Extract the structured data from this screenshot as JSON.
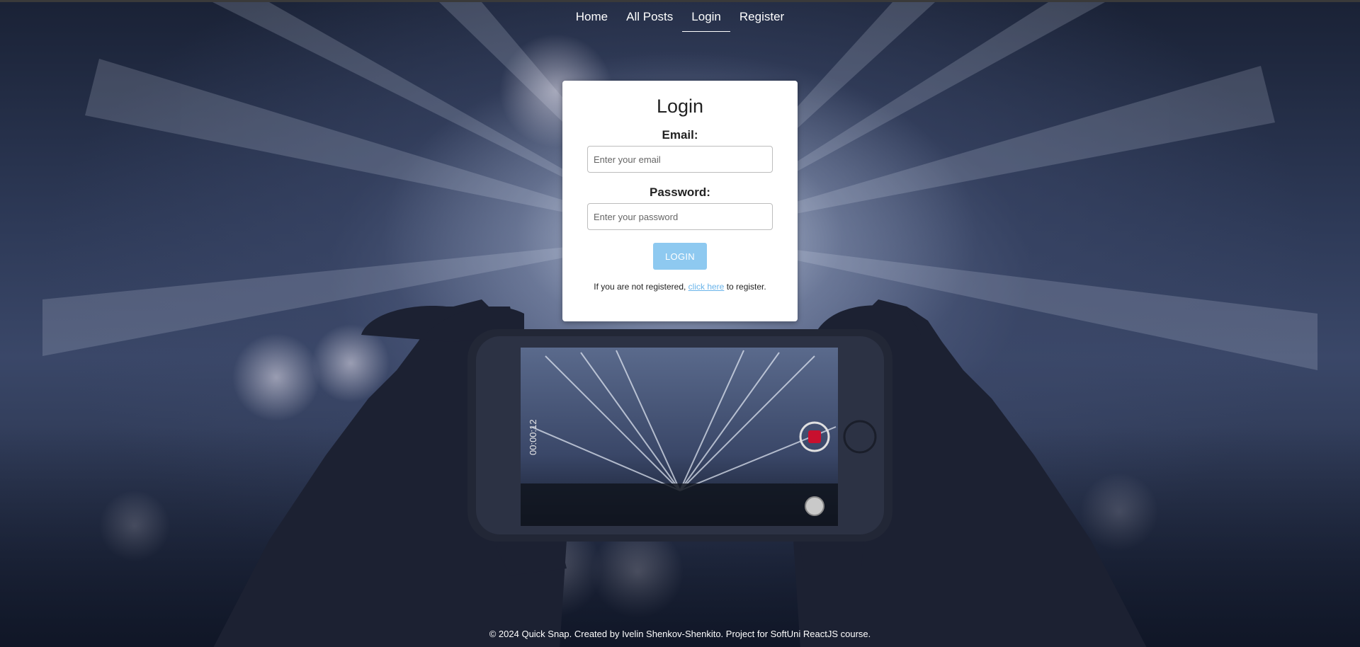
{
  "nav": {
    "items": [
      {
        "label": "Home",
        "active": false
      },
      {
        "label": "All Posts",
        "active": false
      },
      {
        "label": "Login",
        "active": true
      },
      {
        "label": "Register",
        "active": false
      }
    ]
  },
  "login": {
    "title": "Login",
    "email_label": "Email:",
    "email_placeholder": "Enter your email",
    "password_label": "Password:",
    "password_placeholder": "Enter your password",
    "submit_label": "LOGIN",
    "note_before": "If you are not registered, ",
    "note_link": "click here",
    "note_after": " to register."
  },
  "background": {
    "phone_timer": "00:00:12"
  },
  "footer": {
    "text": "© 2024 Quick Snap. Created by Ivelin Shenkov-Shenkito. Project for SoftUni ReactJS course."
  },
  "colors": {
    "button": "#8ec9f0",
    "link": "#6ab4ea",
    "record": "#c8102e"
  }
}
